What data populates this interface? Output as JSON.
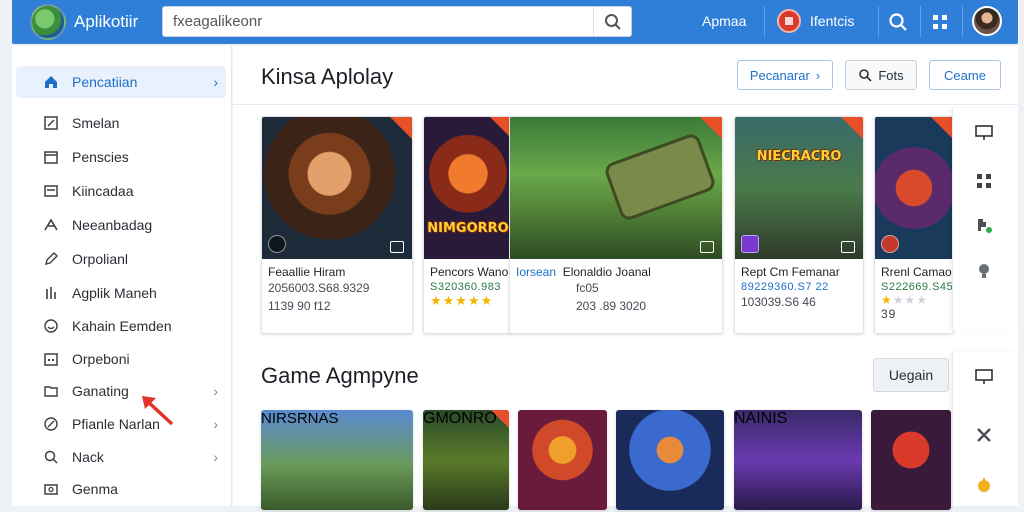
{
  "app": {
    "title": "Aplikotiir"
  },
  "search": {
    "value": "fxeagalikeonr",
    "placeholder": ""
  },
  "topbar": {
    "link": "Apmaa",
    "badge_text": "Ifentcis"
  },
  "sidebar": {
    "items": [
      {
        "label": "Pencatiian",
        "icon": "home-icon",
        "chevron": "›",
        "active": true
      },
      {
        "label": "Smelan",
        "icon": "edit-box-icon"
      },
      {
        "label": "Penscies",
        "icon": "calendar-icon"
      },
      {
        "label": "Kiincadaa",
        "icon": "window-icon"
      },
      {
        "label": "Neeanbadag",
        "icon": "share-icon"
      },
      {
        "label": "Orpolianl",
        "icon": "pencil-icon"
      },
      {
        "label": "Agplik Maneh",
        "icon": "chart-icon"
      },
      {
        "label": "Kahain Eemden",
        "icon": "smile-icon"
      },
      {
        "label": "Orpeboni",
        "icon": "calendar-grid-icon"
      },
      {
        "label": "Ganating",
        "icon": "folder-icon",
        "chevron": "›"
      },
      {
        "label": "Pfianle Narlan",
        "icon": "tag-icon",
        "chevron": "›"
      },
      {
        "label": "Nack",
        "icon": "search-icon",
        "chevron": "›"
      },
      {
        "label": "Genma",
        "icon": "camera-icon"
      }
    ]
  },
  "section1": {
    "title": "Kinsa Aplolay",
    "buttons": {
      "primary": "Pecanarar",
      "filter": "Fots",
      "game": "Ceame"
    },
    "cards": [
      {
        "title": "Feaallie Hiram",
        "meta": "2056003.S68.9329",
        "number": "1139 90 f12"
      },
      {
        "title": "Pencors Wano",
        "meta": "S320360.983",
        "stars": 5,
        "art": "NIMGORRO"
      },
      {
        "title": "Elonaldio Joanal",
        "tag": "Iorsean",
        "meta": "fc05",
        "number": "203 .89 3020"
      },
      {
        "title": "Rept Cm Femanar",
        "meta": "89229360.S7 22",
        "number": "103039.S6 46",
        "art": "NIECRACRO"
      },
      {
        "title": "Rrenl Camao",
        "meta": "S222669.S45",
        "number": "39",
        "stars": 1
      }
    ]
  },
  "section2": {
    "title": "Game Agmpyne",
    "button": "Uegain",
    "thumbs": [
      {
        "art": "NIRSRNAS"
      },
      {
        "art": "GMONRO"
      },
      {
        "art": ""
      },
      {
        "art": ""
      },
      {
        "art": "NAINIS"
      },
      {
        "art": ""
      }
    ]
  },
  "rail_icons": [
    "monitor-icon",
    "grid-icon",
    "puzzle-icon",
    "lightbulb-icon",
    "monitor-icon",
    "tools-icon",
    "notification-icon"
  ],
  "colors": {
    "brand": "#2f7fd8",
    "accent": "#e8502a",
    "active": "#1f6fc9"
  }
}
